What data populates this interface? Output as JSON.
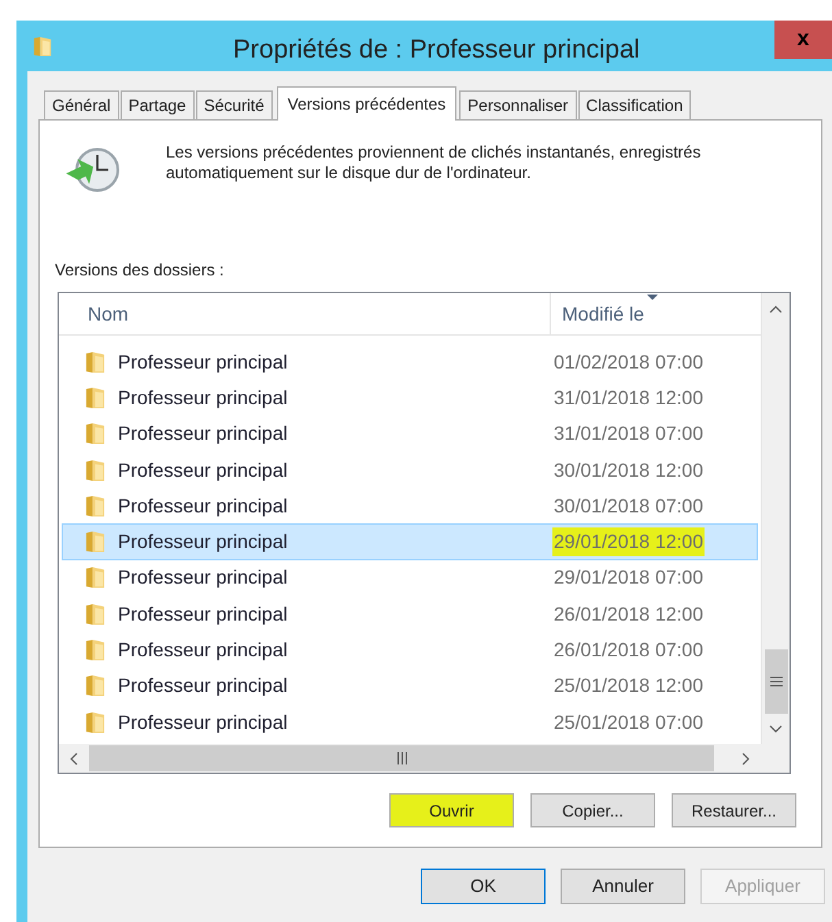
{
  "window": {
    "title": "Propriétés de : Professeur principal",
    "close": "x"
  },
  "tabs": [
    {
      "label": "Général",
      "selected": false
    },
    {
      "label": "Partage",
      "selected": false
    },
    {
      "label": "Sécurité",
      "selected": false
    },
    {
      "label": "Versions précédentes",
      "selected": true
    },
    {
      "label": "Personnaliser",
      "selected": false
    },
    {
      "label": "Classification",
      "selected": false
    }
  ],
  "description": "Les versions précédentes proviennent de clichés instantanés, enregistrés automatiquement sur le disque dur de l'ordinateur.",
  "list_label": "Versions des dossiers :",
  "table": {
    "columns": [
      "Nom",
      "Modifié le"
    ],
    "rows": [
      {
        "name": "Professeur principal",
        "date": "01/02/2018 07:00",
        "selected": false,
        "highlighted": false
      },
      {
        "name": "Professeur principal",
        "date": "31/01/2018 12:00",
        "selected": false,
        "highlighted": false
      },
      {
        "name": "Professeur principal",
        "date": "31/01/2018 07:00",
        "selected": false,
        "highlighted": false
      },
      {
        "name": "Professeur principal",
        "date": "30/01/2018 12:00",
        "selected": false,
        "highlighted": false
      },
      {
        "name": "Professeur principal",
        "date": "30/01/2018 07:00",
        "selected": false,
        "highlighted": false
      },
      {
        "name": "Professeur principal",
        "date": "29/01/2018 12:00",
        "selected": true,
        "highlighted": true
      },
      {
        "name": "Professeur principal",
        "date": "29/01/2018 07:00",
        "selected": false,
        "highlighted": false
      },
      {
        "name": "Professeur principal",
        "date": "26/01/2018 12:00",
        "selected": false,
        "highlighted": false
      },
      {
        "name": "Professeur principal",
        "date": "26/01/2018 07:00",
        "selected": false,
        "highlighted": false
      },
      {
        "name": "Professeur principal",
        "date": "25/01/2018 12:00",
        "selected": false,
        "highlighted": false
      },
      {
        "name": "Professeur principal",
        "date": "25/01/2018 07:00",
        "selected": false,
        "highlighted": false
      }
    ]
  },
  "actions": [
    {
      "label": "Ouvrir",
      "highlighted": true
    },
    {
      "label": "Copier...",
      "highlighted": false
    },
    {
      "label": "Restaurer...",
      "highlighted": false
    }
  ],
  "buttons": [
    {
      "label": "OK",
      "default": true,
      "disabled": false
    },
    {
      "label": "Annuler",
      "default": false,
      "disabled": false
    },
    {
      "label": "Appliquer",
      "default": false,
      "disabled": true
    }
  ]
}
